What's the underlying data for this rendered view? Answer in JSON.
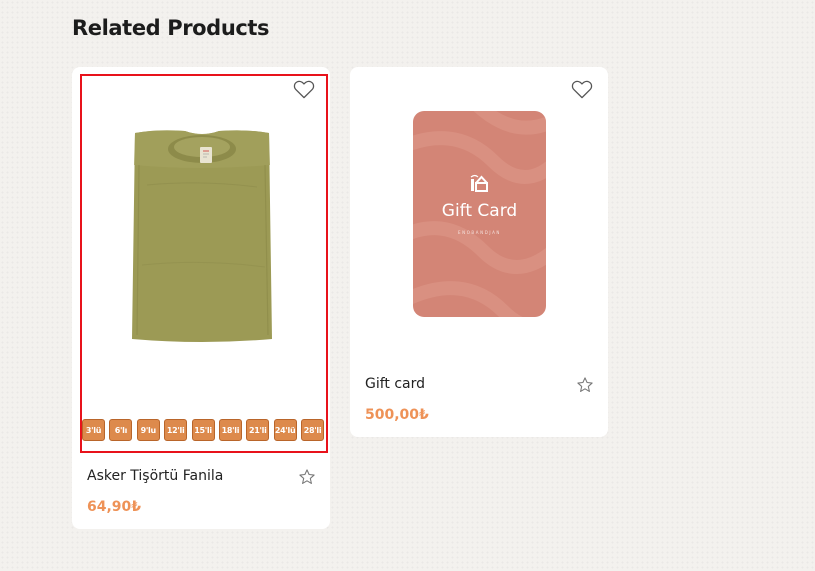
{
  "section": {
    "title": "Related Products"
  },
  "products": [
    {
      "name": "Asker Tişörtü Fanila",
      "price": "64,90₺",
      "image": "olive-tshirt",
      "sizes": [
        "3'lü",
        "6'lı",
        "9'lu",
        "12'li",
        "15'li",
        "18'li",
        "21'li",
        "24'lü",
        "28'li"
      ],
      "selected": true
    },
    {
      "name": "Gift card",
      "price": "500,00₺",
      "image": "gift-card",
      "card_title": "Gift Card",
      "card_subtitle": "ENOBANDJAN"
    }
  ],
  "icons": {
    "favorite": "heart-icon",
    "rate": "star-icon"
  },
  "colors": {
    "price": "#ee9257",
    "size_badge": "#dd8a4c",
    "highlight": "#e8121b",
    "gift_card": "#d38576",
    "tshirt": "#9a9a52"
  }
}
